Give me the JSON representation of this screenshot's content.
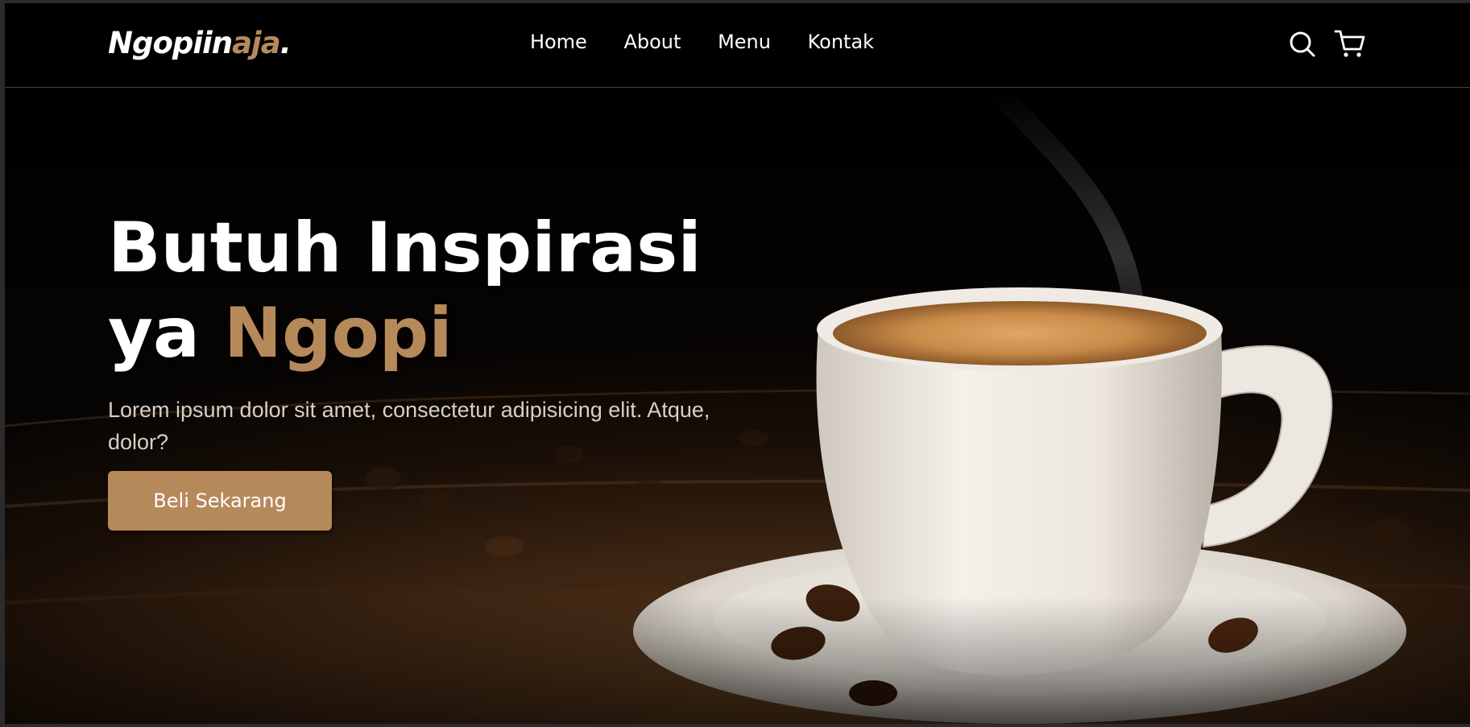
{
  "brand": {
    "name_main": "Ngopiin",
    "name_accent": "aja",
    "name_suffix": "."
  },
  "nav": {
    "links": [
      {
        "label": "Home"
      },
      {
        "label": "About"
      },
      {
        "label": "Menu"
      },
      {
        "label": "Kontak"
      }
    ],
    "icons": [
      "search-icon",
      "cart-icon"
    ]
  },
  "hero": {
    "title_line1": "Butuh Inspirasi",
    "title_line2_prefix": "ya",
    "title_line2_highlight": "Ngopi",
    "description": "Lorem ipsum dolor sit amet, consectetur adipisicing elit. Atque, dolor?",
    "cta_label": "Beli Sekarang",
    "image": "coffee-cup-on-saucer"
  },
  "colors": {
    "accent": "#b6895b",
    "background": "#000000",
    "text": "#ffffff"
  }
}
